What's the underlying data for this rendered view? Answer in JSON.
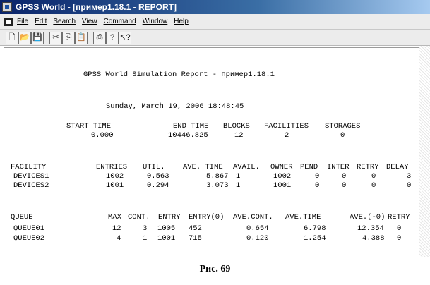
{
  "window": {
    "title": "GPSS World - [пример1.18.1 - REPORT]"
  },
  "menu": {
    "items": [
      "File",
      "Edit",
      "Search",
      "View",
      "Command",
      "Window",
      "Help"
    ]
  },
  "toolbar": {
    "buttons": [
      "new-icon",
      "open-icon",
      "save-icon",
      "cut-icon",
      "copy-icon",
      "paste-icon",
      "print-icon",
      "help-icon",
      "context-help-icon"
    ],
    "glyphs": {
      "new": "🗋",
      "open": "📂",
      "save": "💾",
      "cut": "✂",
      "copy": "⎘",
      "paste": "📋",
      "print": "⎙",
      "help": "?",
      "context_help": "↖?"
    }
  },
  "report": {
    "header": "GPSS World Simulation Report - пример1.18.1",
    "date": "Sunday, March 19, 2006 18:48:45",
    "summary": {
      "headers": [
        "START TIME",
        "END TIME",
        "BLOCKS",
        "FACILITIES",
        "STORAGES"
      ],
      "values": [
        "0.000",
        "10446.825",
        "12",
        "2",
        "0"
      ]
    },
    "facility": {
      "headers": [
        "FACILITY",
        "ENTRIES",
        "UTIL.",
        "AVE. TIME",
        "AVAIL.",
        "OWNER",
        "PEND",
        "INTER",
        "RETRY",
        "DELAY"
      ],
      "rows": [
        [
          "DEVICES1",
          "1002",
          "0.563",
          "5.867",
          "1",
          "1002",
          "0",
          "0",
          "0",
          "3"
        ],
        [
          "DEVICES2",
          "1001",
          "0.294",
          "3.073",
          "1",
          "1001",
          "0",
          "0",
          "0",
          "0"
        ]
      ]
    },
    "queue": {
      "headers": [
        "QUEUE",
        "MAX",
        "CONT.",
        "ENTRY",
        "ENTRY(0)",
        "AVE.CONT.",
        "AVE.TIME",
        "AVE.(-0)",
        "RETRY"
      ],
      "rows": [
        [
          "QUEUE01",
          "12",
          "3",
          "1005",
          "452",
          "0.654",
          "6.798",
          "12.354",
          "0"
        ],
        [
          "QUEUE02",
          "4",
          "1",
          "1001",
          "715",
          "0.120",
          "1.254",
          "4.388",
          "0"
        ]
      ]
    }
  },
  "caption": "Рис. 69"
}
